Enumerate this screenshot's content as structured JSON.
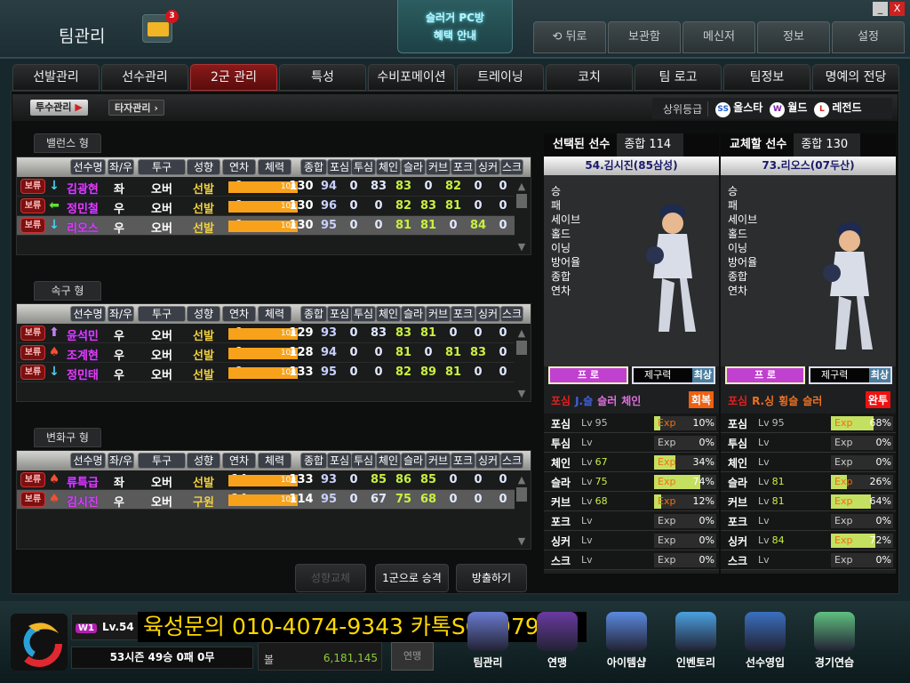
{
  "header": {
    "title": "팀관리",
    "mail_count": "3",
    "pcbang": [
      "슬러거 PC방",
      "혜택 안내"
    ],
    "nav": [
      "뒤로",
      "보관함",
      "메신저",
      "정보",
      "설정"
    ],
    "window": [
      "_",
      "X"
    ]
  },
  "tabs": [
    "선발관리",
    "선수관리",
    "2군 관리",
    "특성",
    "수비포메이션",
    "트레이닝",
    "코치",
    "팀 로고",
    "팀정보",
    "명예의 전당"
  ],
  "active_tab": 2,
  "subtabs": {
    "pitcher": "투수관리",
    "batter": "타자관리"
  },
  "grades": {
    "label": "상위등급",
    "items": [
      {
        "icon": "SS",
        "label": "올스타",
        "color": "#2060d0"
      },
      {
        "icon": "W",
        "label": "월드",
        "color": "#8020b0"
      },
      {
        "icon": "L",
        "label": "레전드",
        "color": "#d02020"
      }
    ]
  },
  "columns": [
    "선수명",
    "좌/우",
    "투구",
    "성향",
    "연차",
    "체력",
    "종합",
    "포심",
    "투심",
    "체인",
    "슬라",
    "커브",
    "포크",
    "싱커",
    "스크"
  ],
  "hold_label": "보류",
  "groups": [
    {
      "label": "밸런스 형",
      "rows": [
        {
          "arrow": "down",
          "name": "김광현",
          "hand": "좌",
          "pitch": "오버",
          "type": "선발",
          "year": "9",
          "stamina": "100",
          "vals": [
            130,
            94,
            0,
            83,
            83,
            0,
            82,
            0,
            0
          ]
        },
        {
          "arrow": "left",
          "name": "정민철",
          "hand": "우",
          "pitch": "오버",
          "type": "선발",
          "year": "9",
          "stamina": "100",
          "vals": [
            130,
            96,
            0,
            0,
            82,
            83,
            81,
            0,
            0
          ]
        },
        {
          "arrow": "down",
          "name": "리오스",
          "hand": "우",
          "pitch": "오버",
          "type": "선발",
          "year": "9",
          "stamina": "100",
          "vals": [
            130,
            95,
            0,
            0,
            81,
            81,
            0,
            84,
            0
          ],
          "selected": true
        }
      ]
    },
    {
      "label": "속구 형",
      "rows": [
        {
          "arrow": "up",
          "name": "윤석민",
          "hand": "우",
          "pitch": "오버",
          "type": "선발",
          "year": "9",
          "stamina": "100",
          "vals": [
            129,
            93,
            0,
            83,
            83,
            81,
            0,
            0,
            0
          ]
        },
        {
          "arrow": "hot",
          "name": "조계현",
          "hand": "우",
          "pitch": "오버",
          "type": "선발",
          "year": "9",
          "stamina": "100",
          "vals": [
            128,
            94,
            0,
            0,
            81,
            0,
            81,
            83,
            0
          ]
        },
        {
          "arrow": "down",
          "name": "정민태",
          "hand": "우",
          "pitch": "오버",
          "type": "선발",
          "year": "9",
          "stamina": "100",
          "vals": [
            133,
            95,
            0,
            0,
            82,
            89,
            81,
            0,
            0
          ]
        }
      ]
    },
    {
      "label": "변화구 형",
      "rows": [
        {
          "arrow": "hot",
          "name": "류특급",
          "hand": "좌",
          "pitch": "오버",
          "type": "선발",
          "year": "14",
          "stamina": "100",
          "vals": [
            133,
            93,
            0,
            85,
            86,
            85,
            0,
            0,
            0
          ]
        },
        {
          "arrow": "hot",
          "name": "김시진",
          "hand": "우",
          "pitch": "오버",
          "type": "구원",
          "year": "14",
          "stamina": "100",
          "vals": [
            114,
            95,
            0,
            67,
            75,
            68,
            0,
            0,
            0
          ],
          "selected": true
        }
      ]
    }
  ],
  "actions": [
    "성향교체",
    "1군으로 승격",
    "방출하기"
  ],
  "stat_labels": [
    "승",
    "패",
    "세이브",
    "홀드",
    "이닝",
    "방어율",
    "종합",
    "연차"
  ],
  "panels": [
    {
      "head": "선택된 선수",
      "score_label": "종합",
      "score": "114",
      "name": "54.김시진(85삼성)",
      "grade": "프 로",
      "control_label": "제구력",
      "control": "최상",
      "pitches": [
        {
          "t": "포심",
          "c": "#e02020"
        },
        {
          "t": "J.슬",
          "c": "#4060e0"
        },
        {
          "t": "슬러",
          "c": "#e070e0"
        },
        {
          "t": "체인",
          "c": "#e070e0"
        }
      ],
      "tag": "회복",
      "tag_color": "#f06010",
      "skills": [
        {
          "n": "포심",
          "lv": "95",
          "pct": 10
        },
        {
          "n": "투심",
          "lv": "",
          "pct": 0
        },
        {
          "n": "체인",
          "lv": "67",
          "pct": 34
        },
        {
          "n": "슬라",
          "lv": "75",
          "pct": 74
        },
        {
          "n": "커브",
          "lv": "68",
          "pct": 12
        },
        {
          "n": "포크",
          "lv": "",
          "pct": 0
        },
        {
          "n": "싱커",
          "lv": "",
          "pct": 0
        },
        {
          "n": "스크",
          "lv": "",
          "pct": 0
        }
      ]
    },
    {
      "head": "교체할 선수",
      "score_label": "종합",
      "score": "130",
      "name": "73.리오스(07두산)",
      "grade": "프 로",
      "control_label": "제구력",
      "control": "최상",
      "pitches": [
        {
          "t": "포심",
          "c": "#e02020"
        },
        {
          "t": "R.싱",
          "c": "#f07020"
        },
        {
          "t": "횡슬",
          "c": "#f07020"
        },
        {
          "t": "슬러",
          "c": "#f07020"
        }
      ],
      "tag": "완투",
      "tag_color": "#f01010",
      "skills": [
        {
          "n": "포심",
          "lv": "95",
          "pct": 68
        },
        {
          "n": "투심",
          "lv": "",
          "pct": 0
        },
        {
          "n": "체인",
          "lv": "",
          "pct": 0
        },
        {
          "n": "슬라",
          "lv": "81",
          "pct": 26
        },
        {
          "n": "커브",
          "lv": "81",
          "pct": 64
        },
        {
          "n": "포크",
          "lv": "",
          "pct": 0
        },
        {
          "n": "싱커",
          "lv": "84",
          "pct": 72
        },
        {
          "n": "스크",
          "lv": "",
          "pct": 0
        }
      ]
    }
  ],
  "lv_prefix": "Lv",
  "exp_label": "Exp",
  "footer": {
    "badge": "W1",
    "level": "Lv.54",
    "promo": "육성문의 010-4074-9343 카톡SG7979",
    "season": "53시즌  49승  0패  0무",
    "ball_label": "볼",
    "ball": "6,181,145",
    "league_btn": "연맹",
    "nav": [
      {
        "label": "팀관리",
        "c": "#6a7ad0"
      },
      {
        "label": "연맹",
        "c": "#6a3aa0"
      },
      {
        "label": "아이템샵",
        "c": "#5a8ae0"
      },
      {
        "label": "인벤토리",
        "c": "#4aa0e0"
      },
      {
        "label": "선수영입",
        "c": "#3a70c0"
      },
      {
        "label": "경기연습",
        "c": "#60c080"
      }
    ]
  }
}
